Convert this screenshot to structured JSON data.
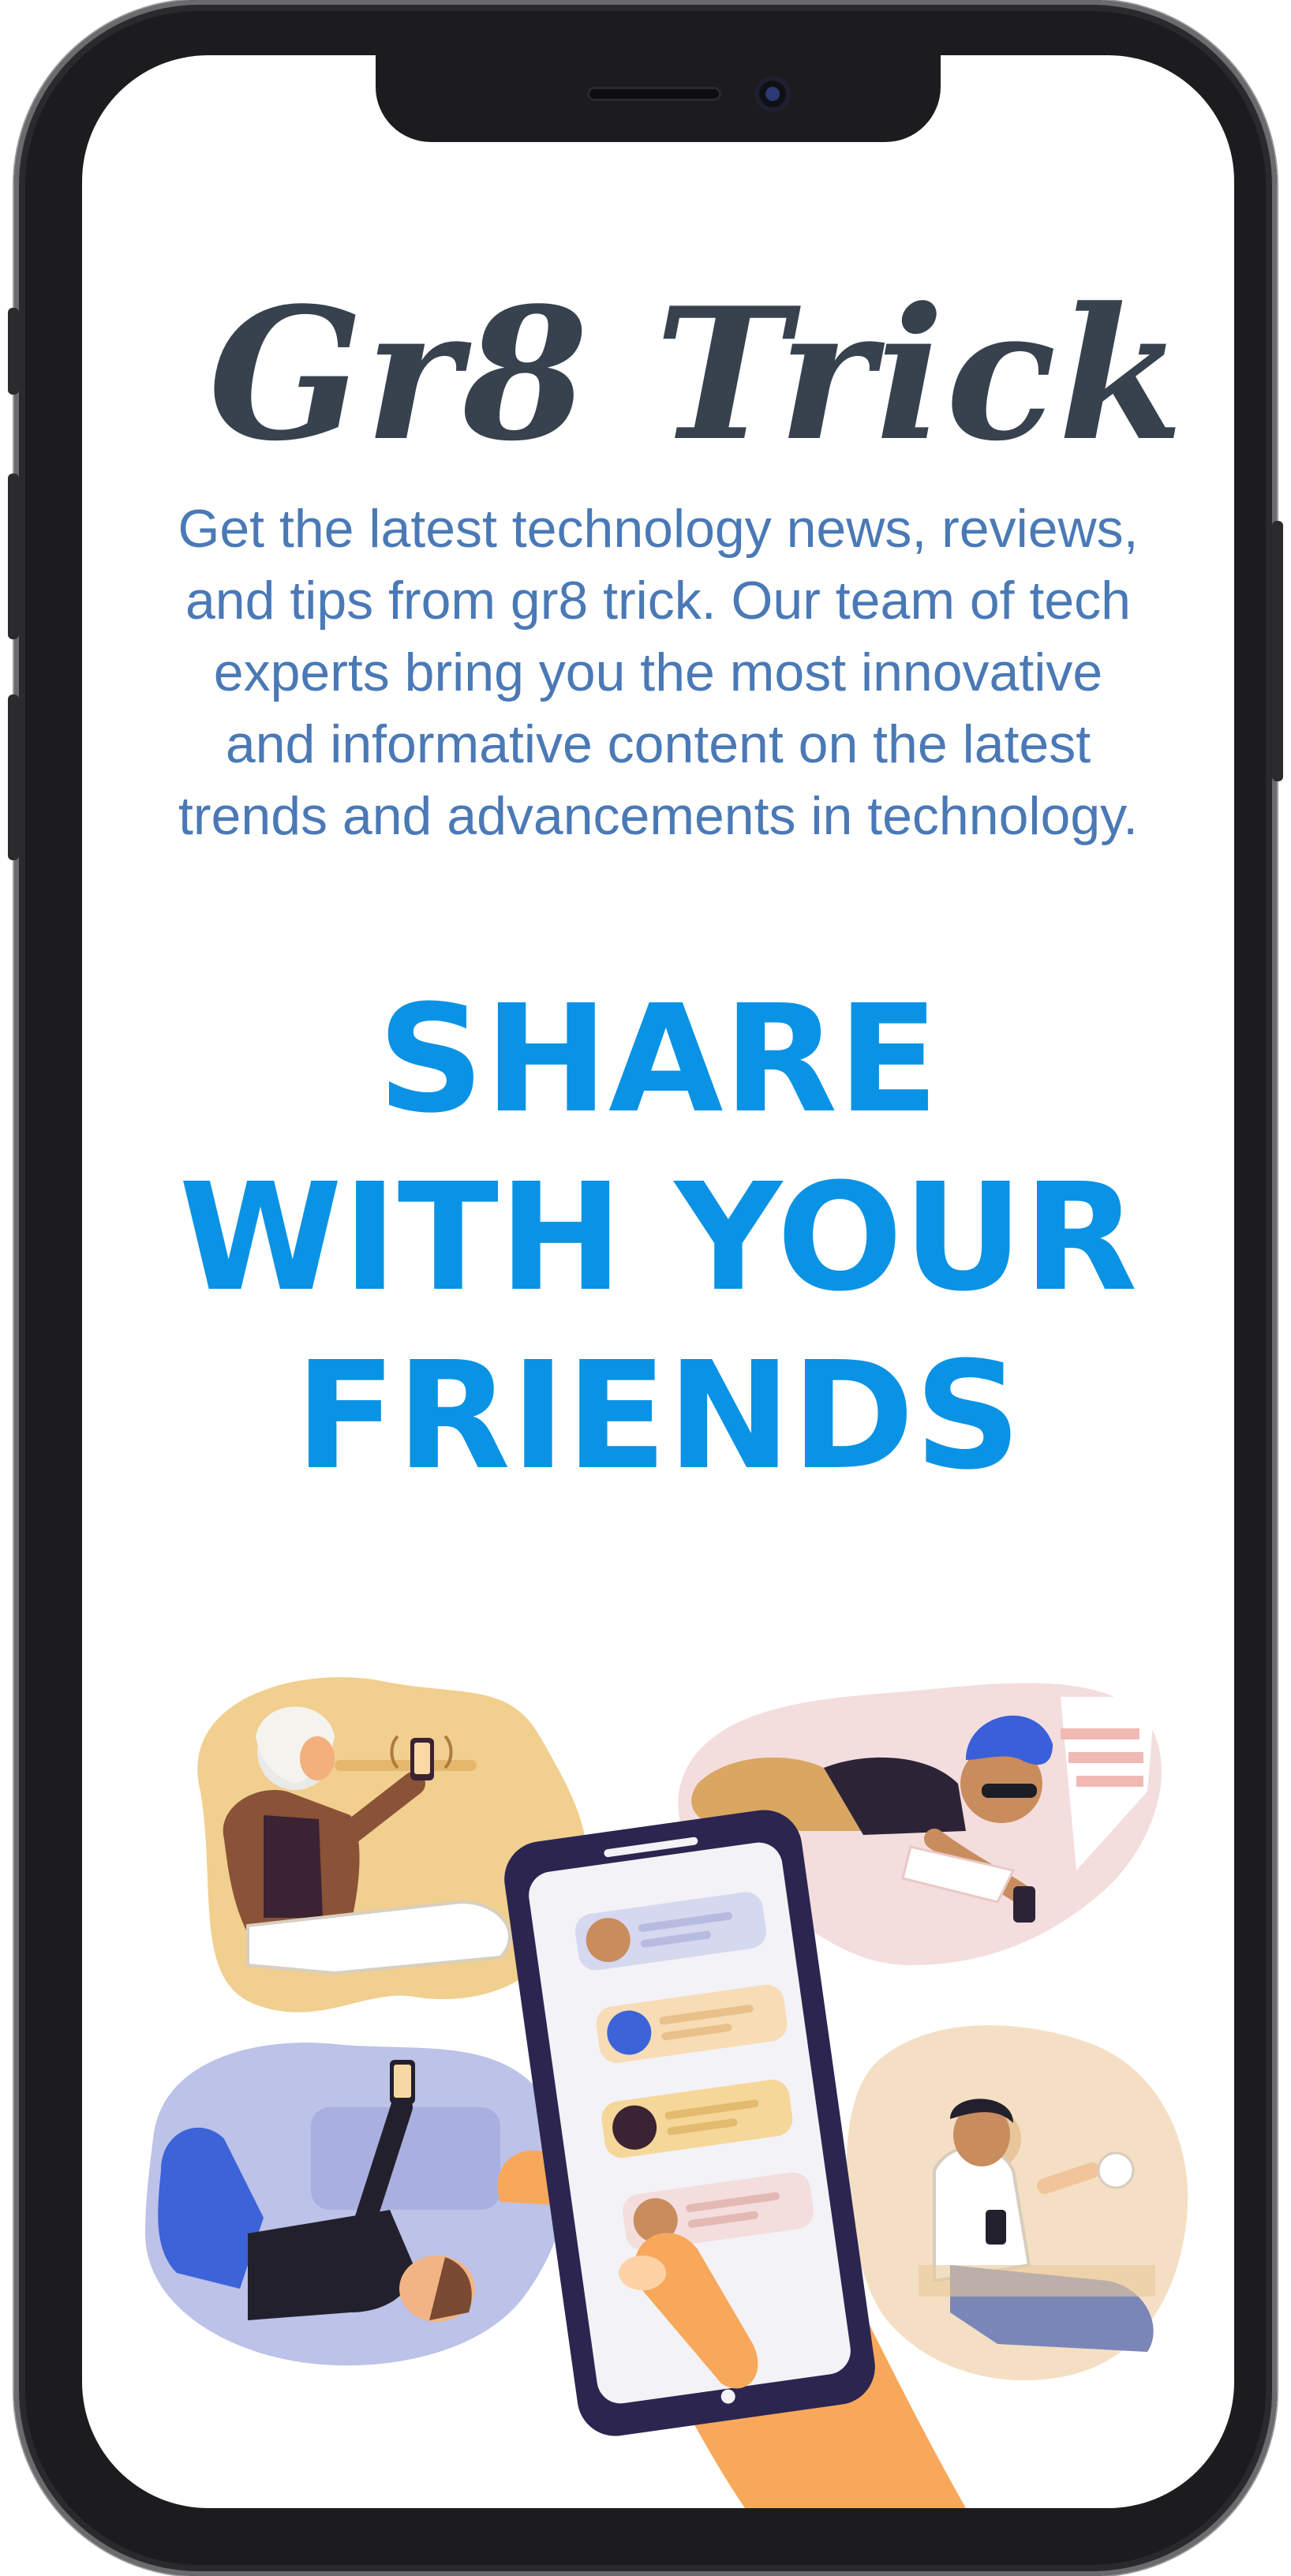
{
  "brand": {
    "logo_text": "Gr8 Trick"
  },
  "hero": {
    "description": "Get the latest technology news, reviews, and tips from gr8 trick. Our team of tech experts bring you the most innovative and informative content on the latest trends and advancements in technology.",
    "headline_lines": [
      "SHARE",
      "WITH YOUR",
      "FRIENDS"
    ]
  },
  "illustration": {
    "name": "people-sharing-on-phones",
    "chat_bubbles": 4
  },
  "colors": {
    "headline": "#0a93e4",
    "description": "#4a79b6",
    "logo": "#37424e",
    "frame": "#1c1c1e"
  }
}
